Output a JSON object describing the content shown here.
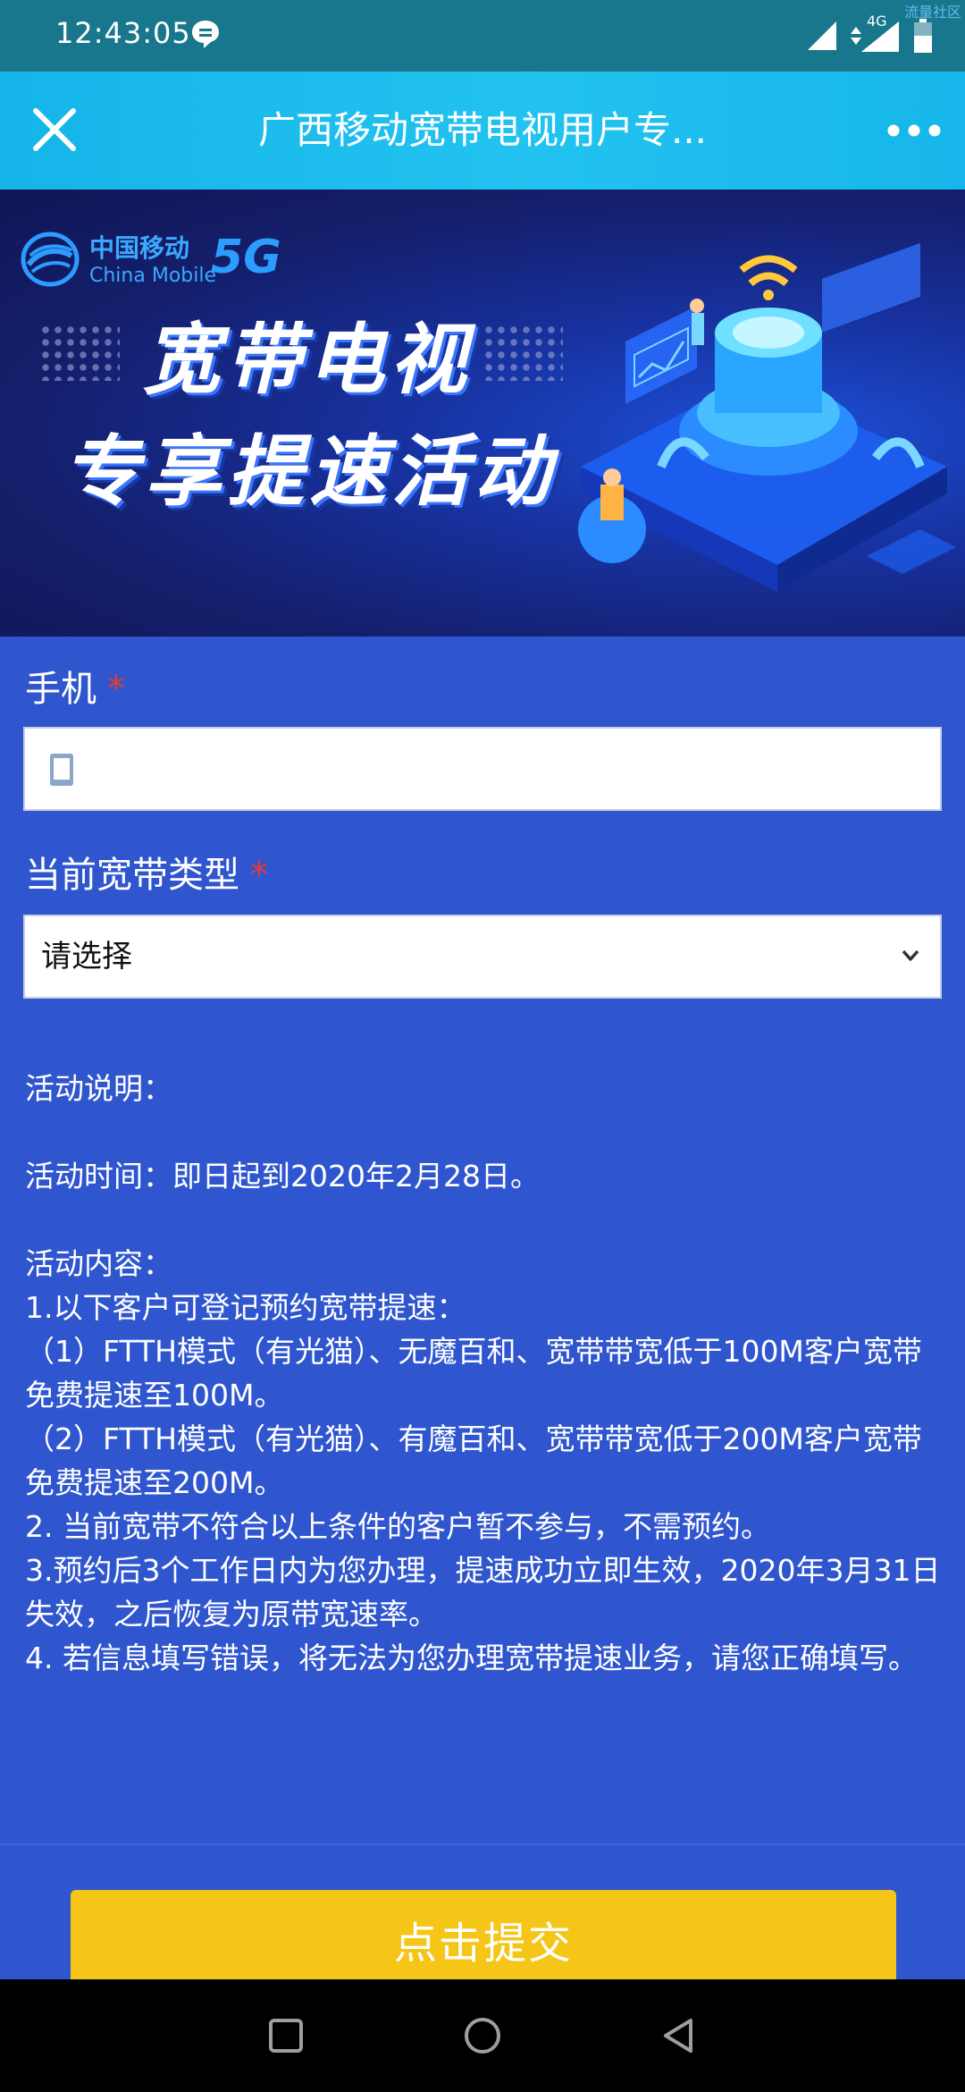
{
  "status_bar": {
    "time": "12:43:05",
    "network": "4G",
    "watermark": "流量社区"
  },
  "header": {
    "title": "广西移动宽带电视用户专..."
  },
  "banner": {
    "logo_cn": "中国移动",
    "logo_en": "China Mobile",
    "logo_5g": "5G",
    "title_line1": "宽带电视",
    "title_line2": "专享提速活动"
  },
  "form": {
    "phone_label": "手机",
    "required_mark": "*",
    "phone_value": "",
    "broadband_label": "当前宽带类型",
    "broadband_selected": "请选择"
  },
  "description": {
    "heading": "活动说明：",
    "time": "活动时间：即日起到2020年2月28日。",
    "content_heading": "活动内容：",
    "items": [
      "1.以下客户可登记预约宽带提速：",
      "（1）FTTH模式（有光猫）、无魔百和、宽带带宽低于100M客户宽带免费提速至100M。",
      "（2）FTTH模式（有光猫）、有魔百和、宽带带宽低于200M客户宽带免费提速至200M。",
      "2. 当前宽带不符合以上条件的客户暂不参与，不需预约。",
      "3.预约后3个工作日内为您办理，提速成功立即生效，2020年3月31日失效，之后恢复为原带宽速率。",
      "4. 若信息填写错误，将无法为您办理宽带提速业务，请您正确填写。"
    ]
  },
  "submit": {
    "label": "点击提交"
  },
  "colors": {
    "page_bg": "#2f56cf",
    "title_bar": "#1cbcee",
    "status_bar": "#18778c",
    "submit_bg": "#f5c518",
    "required": "#e53935"
  },
  "icons": {
    "close": "close-icon",
    "more": "more-icon",
    "phone": "phone-icon",
    "chevron": "chevron-down-icon",
    "nav_recent": "recent-apps-icon",
    "nav_home": "home-icon",
    "nav_back": "back-icon"
  }
}
